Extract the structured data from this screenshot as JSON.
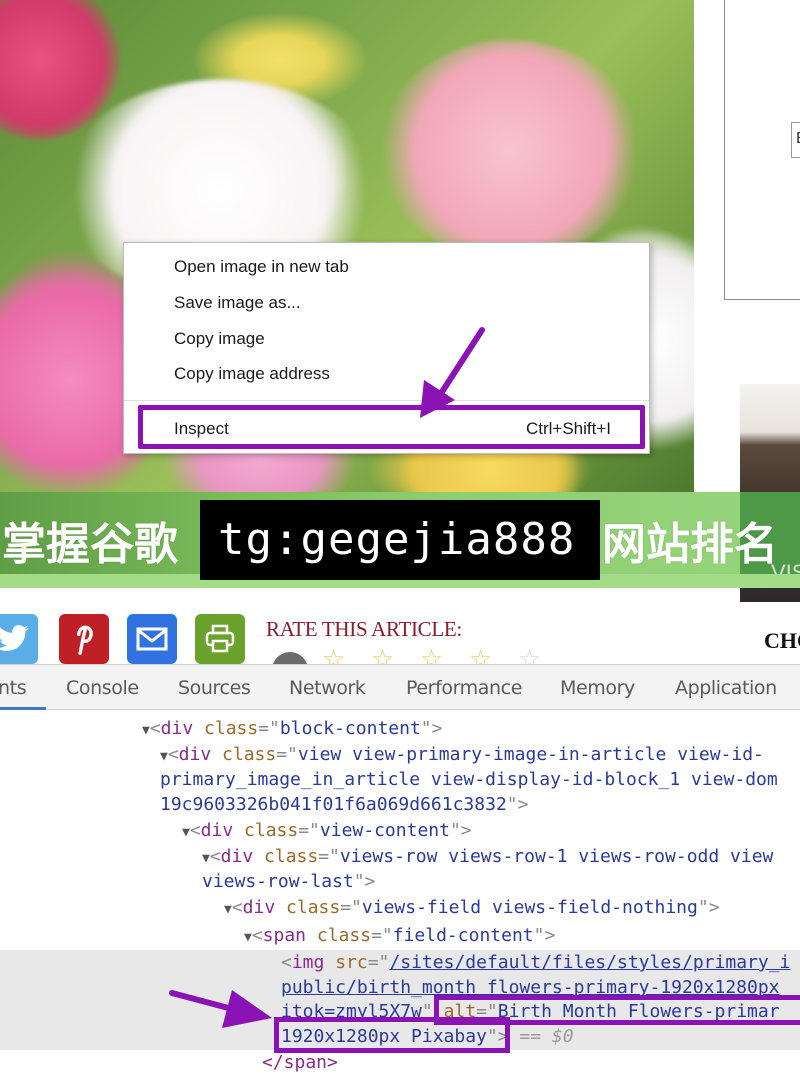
{
  "context_menu": {
    "items": [
      {
        "label": "Open image in new tab"
      },
      {
        "label": "Save image as..."
      },
      {
        "label": "Copy image"
      },
      {
        "label": "Copy image address"
      },
      {
        "label": "Inspect",
        "shortcut": "Ctrl+Shift+I"
      }
    ]
  },
  "watermark": {
    "left_text": "掌握谷歌",
    "center_text": "tg:gegejia888",
    "right_text": "网站排名"
  },
  "sidebar": {
    "input_partial": "E",
    "photo_caption_partial": "VIS",
    "heading_partial": "CHO"
  },
  "share": {
    "buttons": [
      {
        "name": "twitter",
        "color": "#5aaee8"
      },
      {
        "name": "pinterest",
        "color": "#c01f26"
      },
      {
        "name": "email",
        "color": "#2f72e0"
      },
      {
        "name": "print",
        "color": "#6aa22c"
      }
    ],
    "rate_title": "RATE THIS ARTICLE:",
    "rating": {
      "filled": 4,
      "max": 5
    },
    "star_colors": {
      "filled": "#f2c862",
      "empty": "#d8d8d8"
    }
  },
  "devtools": {
    "tabs": [
      {
        "label": "nts",
        "active": true
      },
      {
        "label": "Console"
      },
      {
        "label": "Sources"
      },
      {
        "label": "Network"
      },
      {
        "label": "Performance"
      },
      {
        "label": "Memory"
      },
      {
        "label": "Application"
      }
    ],
    "dom": {
      "l1_tag": "div",
      "l1_attr": "class",
      "l1_val": "block-content",
      "l2_tag": "div",
      "l2_attr": "class",
      "l2_val_a": "view view-primary-image-in-article view-id-",
      "l2_val_b": "primary_image_in_article view-display-id-block_1 view-dom",
      "l2_val_c": "19c9603326b041f01f6a069d661c3832",
      "l3_tag": "div",
      "l3_attr": "class",
      "l3_val": "view-content",
      "l4_tag": "div",
      "l4_attr": "class",
      "l4_val_a": "views-row views-row-1 views-row-odd view",
      "l4_val_b": "views-row-last",
      "l5_tag": "div",
      "l5_attr": "class",
      "l5_val": "views-field views-field-nothing",
      "l6_tag": "span",
      "l6_attr": "class",
      "l6_val": "field-content",
      "img_tag": "img",
      "img_src_attr": "src",
      "img_src_a": "/sites/default/files/styles/primary_i",
      "img_src_b": "public/birth_month_flowers-primary-1920x1280px",
      "img_src_c": "itok=zmyl5X7w",
      "img_alt_attr": "alt",
      "img_alt_a": "Birth Month Flowers-primar",
      "img_alt_b": "1920x1280px Pixabay",
      "img_sel_marker": "== $0",
      "close_span": "</span>"
    }
  },
  "colors": {
    "highlight_purple": "#8b12b4",
    "active_tab_underline": "#3c79c8",
    "rate_title": "#8a1c2c"
  }
}
